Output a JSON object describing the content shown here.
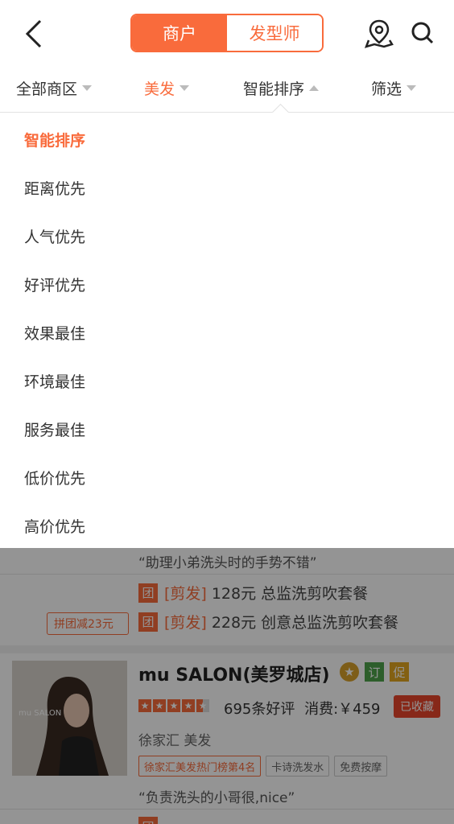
{
  "header": {
    "segments": [
      {
        "label": "商户",
        "active": true
      },
      {
        "label": "发型师",
        "active": false
      }
    ],
    "icons": [
      "back-icon",
      "map-pin-icon",
      "search-icon"
    ]
  },
  "filters": [
    {
      "label": "全部商区",
      "active": false,
      "arrow": "down"
    },
    {
      "label": "美发",
      "active": true,
      "arrow": "down"
    },
    {
      "label": "智能排序",
      "active": false,
      "arrow": "up"
    },
    {
      "label": "筛选",
      "active": false,
      "arrow": "down"
    }
  ],
  "sort_menu": {
    "items": [
      "智能排序",
      "距离优先",
      "人气优先",
      "好评优先",
      "效果最佳",
      "环境最佳",
      "服务最佳",
      "低价优先",
      "高价优先"
    ],
    "selected": "智能排序"
  },
  "background": {
    "listing1": {
      "quote": "“助理小弟洗头时的手势不错”",
      "deals": [
        {
          "badge": "团",
          "tag": "[剪发]",
          "text": "128元 总监洗剪吹套餐"
        },
        {
          "badge": "团",
          "tag": "[剪发]",
          "text": "228元 创意总监洗剪吹套餐"
        }
      ],
      "promo": "拼团减23元"
    },
    "listing2": {
      "name": "mu SALON(美罗城店)",
      "badges": [
        "订",
        "促"
      ],
      "img_caption": "mu  SALON",
      "rating": 4.5,
      "reviews": "695条好评",
      "price": "消费:￥459",
      "fav_label": "已收藏",
      "location": "徐家汇  美发",
      "tags": [
        "徐家汇美发热门榜第4名",
        "卡诗洗发水",
        "免费按摩"
      ],
      "quote": "“负责洗头的小哥很,nice”",
      "deal_badge": "团"
    }
  },
  "colors": {
    "accent": "#f96b3c",
    "fav": "#e8452b",
    "overlay": "rgba(0,0,0,0.42)"
  }
}
